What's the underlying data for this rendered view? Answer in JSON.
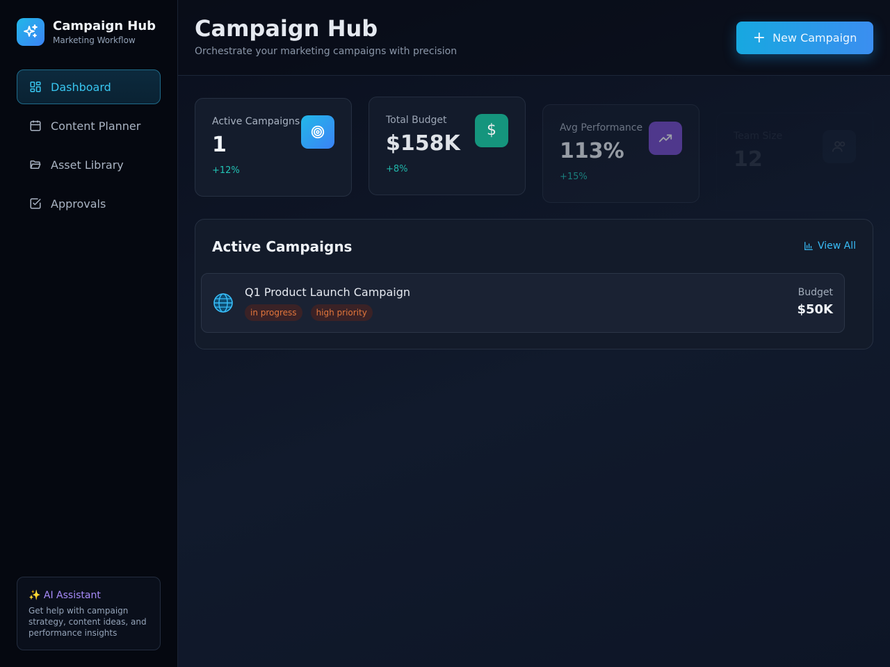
{
  "brand": {
    "title": "Campaign Hub",
    "subtitle": "Marketing Workflow"
  },
  "sidebar": {
    "items": [
      {
        "label": "Dashboard",
        "icon": "dashboard-icon",
        "active": true
      },
      {
        "label": "Content Planner",
        "icon": "calendar-icon",
        "active": false
      },
      {
        "label": "Asset Library",
        "icon": "folder-icon",
        "active": false
      },
      {
        "label": "Approvals",
        "icon": "check-square-icon",
        "active": false
      }
    ]
  },
  "ai_assistant": {
    "title": "✨ AI Assistant",
    "description": "Get help with campaign strategy, content ideas, and performance insights"
  },
  "header": {
    "title": "Campaign Hub",
    "subtitle": "Orchestrate your marketing campaigns with precision",
    "new_button": "New Campaign"
  },
  "stats": [
    {
      "label": "Active Campaigns",
      "value": "1",
      "change": "+12%",
      "icon": "target-icon",
      "color": "#2aa0ec"
    },
    {
      "label": "Total Budget",
      "value": "$158K",
      "change": "+8%",
      "icon": "dollar-icon",
      "color": "#16a085"
    },
    {
      "label": "Avg Performance",
      "value": "113%",
      "change": "+15%",
      "icon": "trending-up-icon",
      "color": "#7b4fd0"
    },
    {
      "label": "Team Size",
      "value": "12",
      "change": "",
      "icon": "users-icon",
      "color": "#3d4f66"
    }
  ],
  "campaigns_panel": {
    "title": "Active Campaigns",
    "view_all": "View All",
    "campaigns": [
      {
        "name": "Q1 Product Launch Campaign",
        "status": "in progress",
        "priority": "high priority",
        "budget_label": "Budget",
        "budget": "$50K",
        "icon": "globe-icon"
      }
    ]
  },
  "colors": {
    "accent": "#38bdf8",
    "tag_text": "#e2763b",
    "positive": "#22c3b5"
  }
}
